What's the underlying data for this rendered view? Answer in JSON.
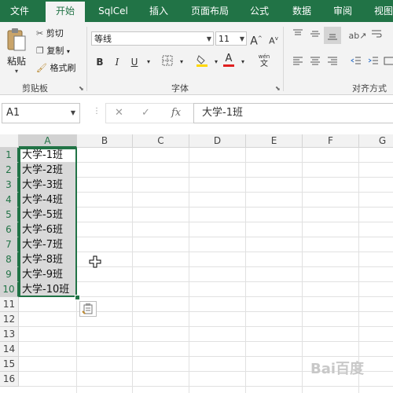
{
  "tabs": [
    {
      "label": "文件",
      "active": false
    },
    {
      "label": "开始",
      "active": true
    },
    {
      "label": "SqlCel",
      "active": false
    },
    {
      "label": "插入",
      "active": false
    },
    {
      "label": "页面布局",
      "active": false
    },
    {
      "label": "公式",
      "active": false
    },
    {
      "label": "数据",
      "active": false
    },
    {
      "label": "审阅",
      "active": false
    },
    {
      "label": "视图",
      "active": false
    }
  ],
  "clipboard": {
    "paste_label": "粘贴",
    "cut_label": "剪切",
    "copy_label": "复制",
    "format_painter_label": "格式刷",
    "group_label": "剪贴板"
  },
  "font": {
    "family": "等线",
    "size": "11",
    "group_label": "字体",
    "wen_label": "wén",
    "bold": "B",
    "italic": "I",
    "underline": "U",
    "grow": "A",
    "shrink": "A",
    "font_color_letter": "A"
  },
  "alignment": {
    "group_label": "对齐方式"
  },
  "namebox": {
    "value": "A1"
  },
  "formula": {
    "value": "大学-1班",
    "fx_label": "fx"
  },
  "columns": [
    "A",
    "B",
    "C",
    "D",
    "E",
    "F",
    "G"
  ],
  "rows": [
    "1",
    "2",
    "3",
    "4",
    "5",
    "6",
    "7",
    "8",
    "9",
    "10",
    "11",
    "12",
    "13",
    "14",
    "15",
    "16"
  ],
  "cells_a": [
    "大学-1班",
    "大学-2班",
    "大学-3班",
    "大学-4班",
    "大学-5班",
    "大学-6班",
    "大学-7班",
    "大学-8班",
    "大学-9班",
    "大学-10班"
  ],
  "watermark": "Bai百度",
  "colors": {
    "accent": "#217346",
    "selection": "#d9d9d9",
    "font_color_bar": "#e02020",
    "fill_color_bar": "#ffd700"
  }
}
